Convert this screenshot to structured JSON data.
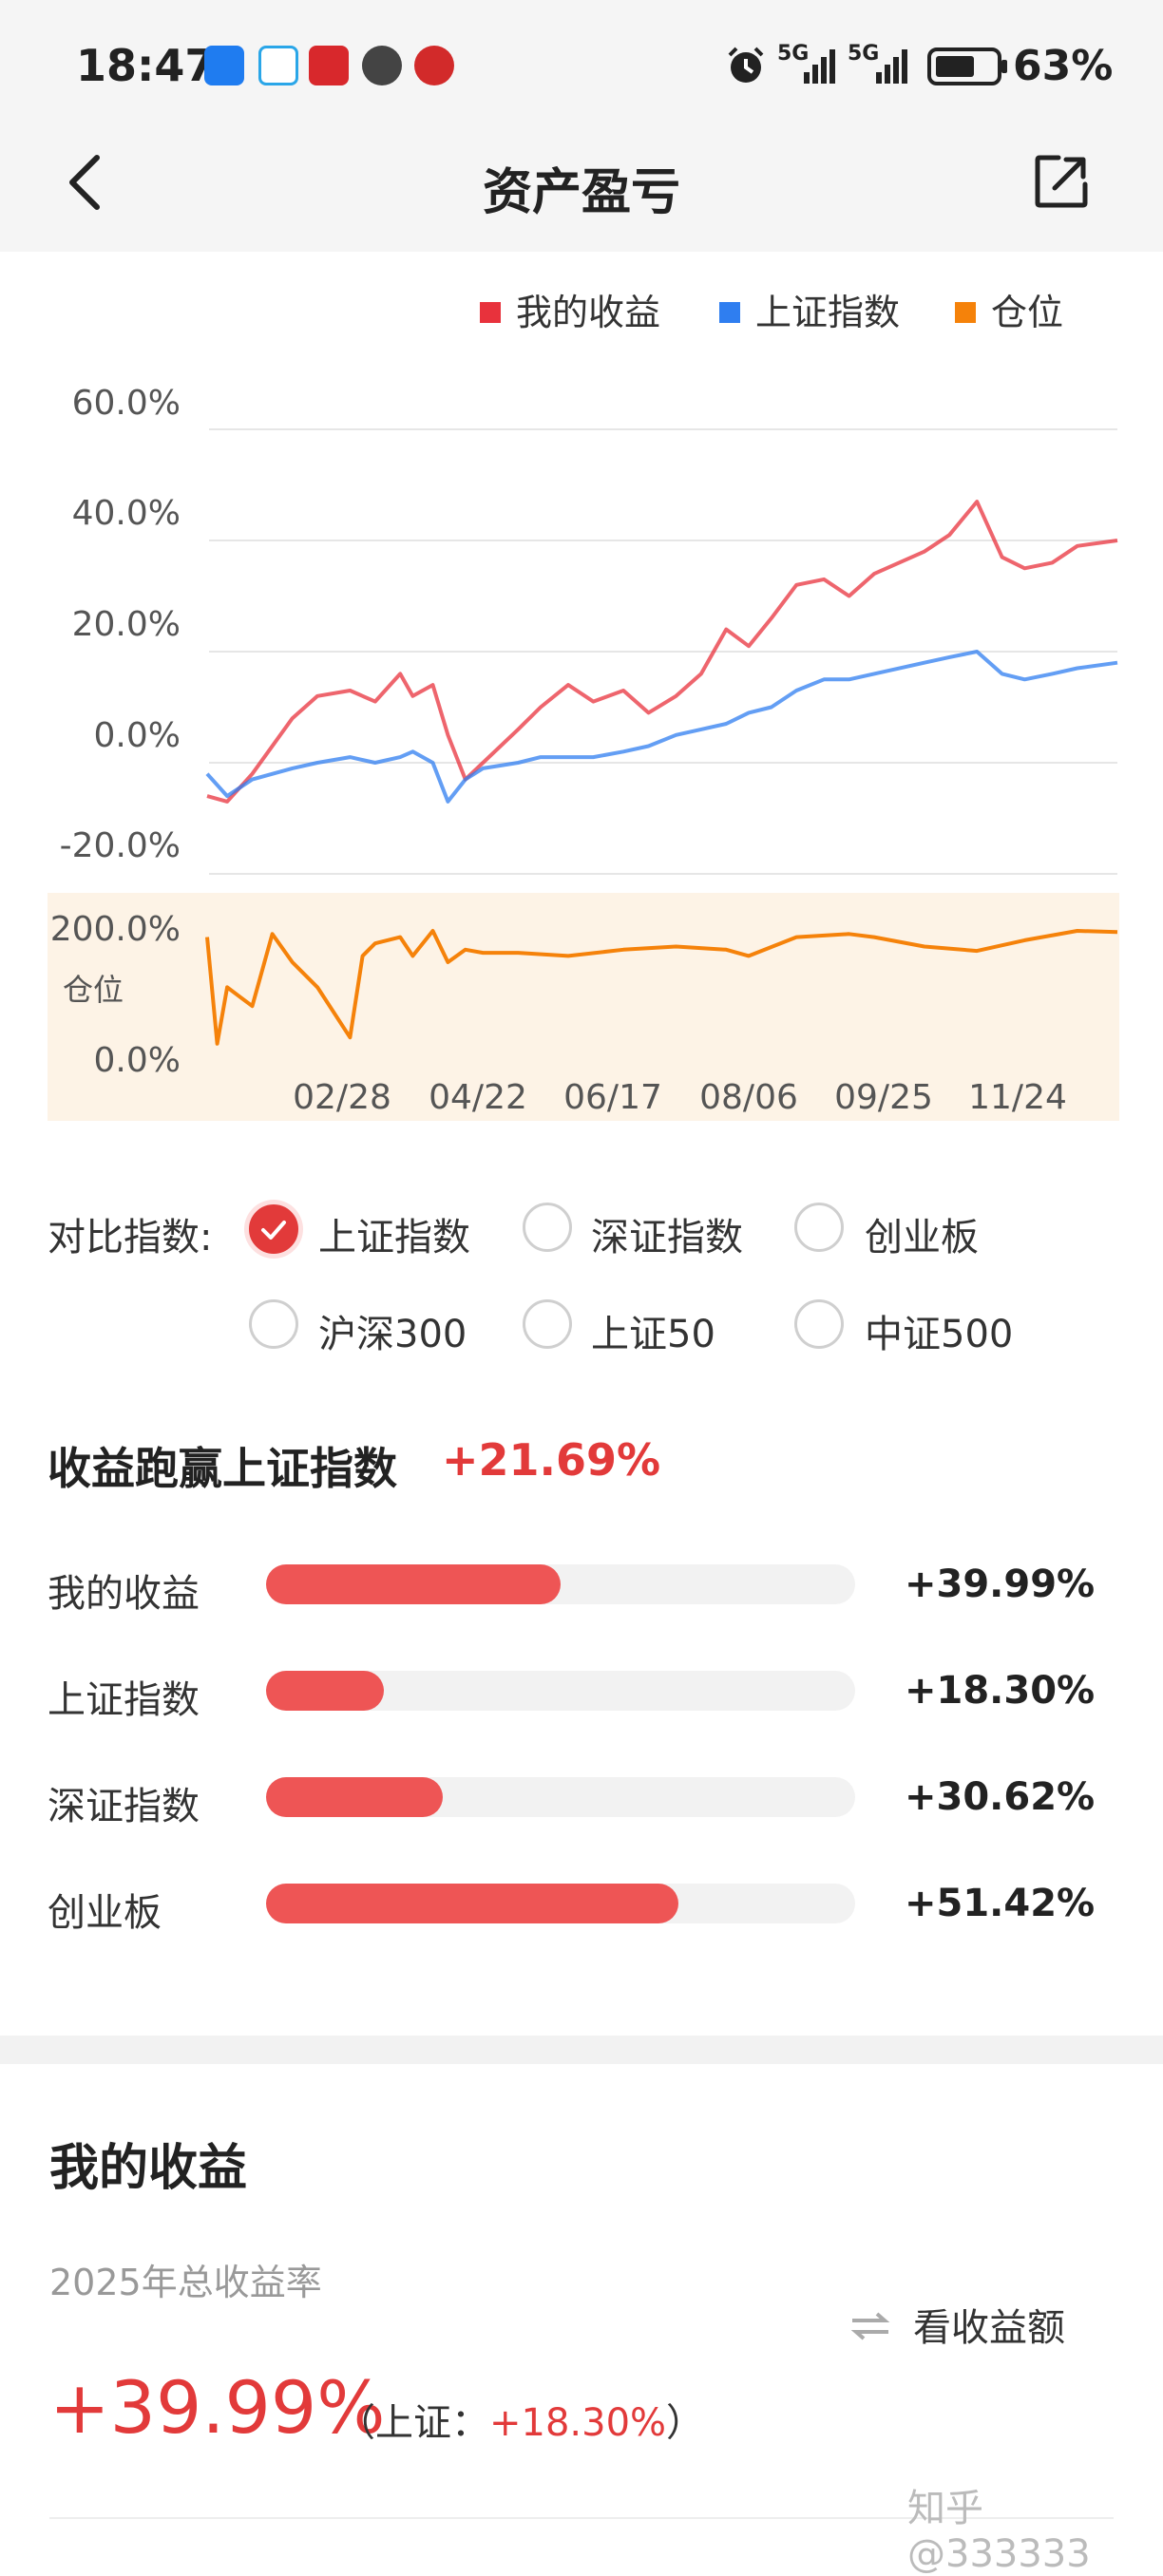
{
  "status_bar": {
    "time": "18:47",
    "battery": "63%",
    "signal_1": "5G",
    "signal_2": "5G",
    "icons": [
      "alipay-icon",
      "cloud-icon",
      "bank-icon",
      "audio-icon",
      "merchants-bank-icon",
      "alarm-icon"
    ]
  },
  "header": {
    "title": "资产盈亏",
    "back_icon": "chevron-left-icon",
    "share_icon": "share-external-icon"
  },
  "legend": [
    {
      "label": "我的收益",
      "color": "#e8323c"
    },
    {
      "label": "上证指数",
      "color": "#2f7ef0"
    },
    {
      "label": "仓位",
      "color": "#f5820a"
    }
  ],
  "chart_data": [
    {
      "type": "line",
      "title": "",
      "x_ticks": [
        "02/28",
        "04/22",
        "06/17",
        "08/06",
        "09/25",
        "11/24"
      ],
      "y_ticks": [
        "60.0%",
        "40.0%",
        "20.0%",
        "0.0%",
        "-20.0%"
      ],
      "ylim": [
        -20,
        60
      ],
      "grid": true,
      "legend": "top-right",
      "series": [
        {
          "name": "我的收益",
          "color": "#e8323c",
          "x": [
            "01/02",
            "01/10",
            "01/20",
            "02/05",
            "02/15",
            "02/28",
            "03/10",
            "03/20",
            "03/25",
            "04/02",
            "04/08",
            "04/15",
            "04/22",
            "05/06",
            "05/15",
            "05/26",
            "06/05",
            "06/17",
            "06/27",
            "07/08",
            "07/18",
            "07/28",
            "08/06",
            "08/15",
            "08/25",
            "09/05",
            "09/15",
            "09/25",
            "10/15",
            "10/25",
            "11/05",
            "11/15",
            "11/24",
            "12/05",
            "12/15",
            "12/31"
          ],
          "y": [
            -6,
            -7,
            -2,
            8,
            12,
            13,
            11,
            16,
            12,
            14,
            5,
            -3,
            0,
            6,
            10,
            14,
            11,
            13,
            9,
            12,
            16,
            24,
            21,
            26,
            32,
            33,
            30,
            34,
            38,
            41,
            47,
            37,
            35,
            36,
            39,
            40
          ]
        },
        {
          "name": "上证指数",
          "color": "#2f7ef0",
          "x": [
            "01/02",
            "01/10",
            "01/20",
            "02/05",
            "02/15",
            "02/28",
            "03/10",
            "03/20",
            "03/25",
            "04/02",
            "04/08",
            "04/15",
            "04/22",
            "05/06",
            "05/15",
            "05/26",
            "06/05",
            "06/17",
            "06/27",
            "07/08",
            "07/18",
            "07/28",
            "08/06",
            "08/15",
            "08/25",
            "09/05",
            "09/15",
            "09/25",
            "10/15",
            "10/25",
            "11/05",
            "11/15",
            "11/24",
            "12/05",
            "12/15",
            "12/31"
          ],
          "y": [
            -2,
            -6,
            -3,
            -1,
            0,
            1,
            0,
            1,
            2,
            0,
            -7,
            -3,
            -1,
            0,
            1,
            1,
            1,
            2,
            3,
            5,
            6,
            7,
            9,
            10,
            13,
            15,
            15,
            16,
            18,
            19,
            20,
            16,
            15,
            16,
            17,
            18
          ]
        }
      ]
    },
    {
      "type": "area",
      "title": "",
      "ylabel": "仓位",
      "y_ticks": [
        "200.0%",
        "0.0%"
      ],
      "ylim": [
        0,
        200
      ],
      "series": [
        {
          "name": "仓位",
          "color": "#f5820a",
          "x": [
            "01/02",
            "01/06",
            "01/10",
            "01/20",
            "01/28",
            "02/05",
            "02/15",
            "02/28",
            "03/05",
            "03/10",
            "03/20",
            "03/25",
            "04/02",
            "04/08",
            "04/15",
            "04/22",
            "05/06",
            "05/26",
            "06/17",
            "07/08",
            "07/28",
            "08/06",
            "08/25",
            "09/15",
            "09/25",
            "10/15",
            "11/05",
            "11/24",
            "12/15",
            "12/31"
          ],
          "y": [
            190,
            20,
            110,
            80,
            195,
            150,
            110,
            30,
            160,
            180,
            190,
            160,
            200,
            150,
            170,
            165,
            165,
            160,
            170,
            175,
            170,
            160,
            190,
            195,
            190,
            175,
            168,
            185,
            200,
            198
          ]
        }
      ]
    }
  ],
  "compare": {
    "label": "对比指数:",
    "options": [
      {
        "label": "上证指数",
        "checked": true
      },
      {
        "label": "深证指数",
        "checked": false
      },
      {
        "label": "创业板",
        "checked": false
      },
      {
        "label": "沪深300",
        "checked": false
      },
      {
        "label": "上证50",
        "checked": false
      },
      {
        "label": "中证500",
        "checked": false
      }
    ]
  },
  "beat": {
    "title": "收益跑赢上证指数",
    "value": "+21.69%"
  },
  "bars": [
    {
      "label": "我的收益",
      "value": "+39.99%",
      "fill_fraction": 0.5
    },
    {
      "label": "上证指数",
      "value": "+18.30%",
      "fill_fraction": 0.2
    },
    {
      "label": "深证指数",
      "value": "+30.62%",
      "fill_fraction": 0.3
    },
    {
      "label": "创业板",
      "value": "+51.42%",
      "fill_fraction": 0.7
    }
  ],
  "my_profit": {
    "title": "我的收益",
    "subtitle": "2025年总收益率",
    "toggle_label": "看收益额",
    "total_rate": "+39.99%",
    "index_prefix": "（上证：",
    "index_value": "+18.30%",
    "index_suffix": "）"
  },
  "watermark": "知乎 @333333"
}
